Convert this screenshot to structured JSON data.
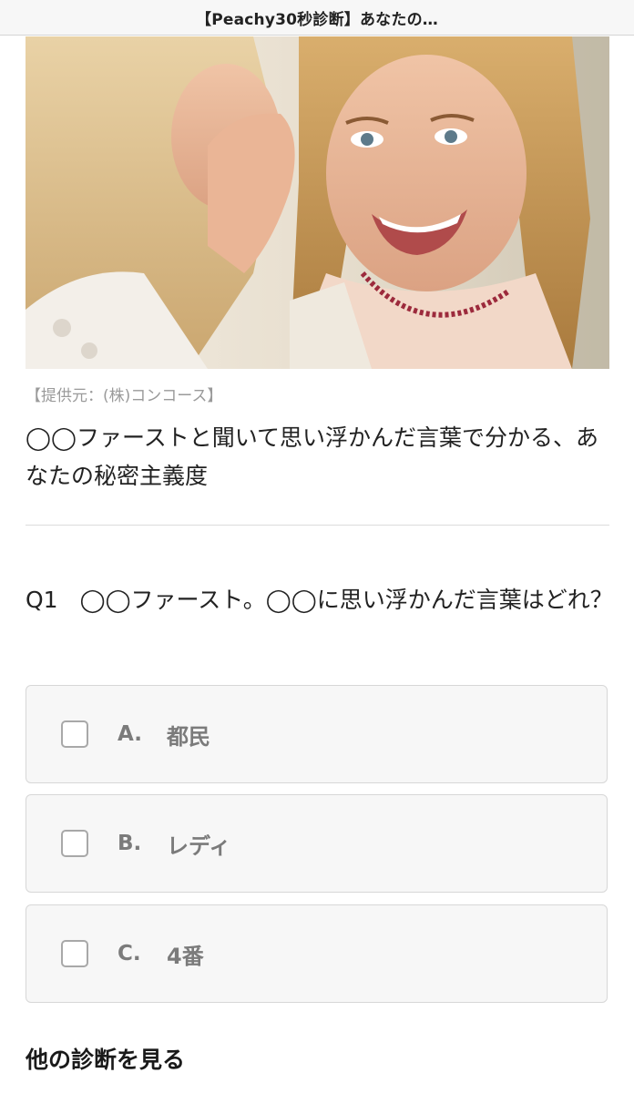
{
  "header": {
    "title": "【Peachy30秒診断】あなたの…"
  },
  "hero": {
    "credit": "【提供元：(株)コンコース】"
  },
  "article": {
    "headline": "◯◯ファーストと聞いて思い浮かんだ言葉で分かる、あなたの秘密主義度"
  },
  "quiz": {
    "question_number": "Q1",
    "question_text": "◯◯ファースト。◯◯に思い浮かんだ言葉はどれ？",
    "options": [
      {
        "letter": "A.",
        "text": "都民"
      },
      {
        "letter": "B.",
        "text": "レディ"
      },
      {
        "letter": "C.",
        "text": "4番"
      }
    ]
  },
  "more": {
    "heading": "他の診断を見る"
  },
  "colors": {
    "option_bg": "#f7f7f7",
    "option_border": "#d7d7d7",
    "option_text": "#7b7b7b",
    "credit_text": "#9a9a9a"
  }
}
